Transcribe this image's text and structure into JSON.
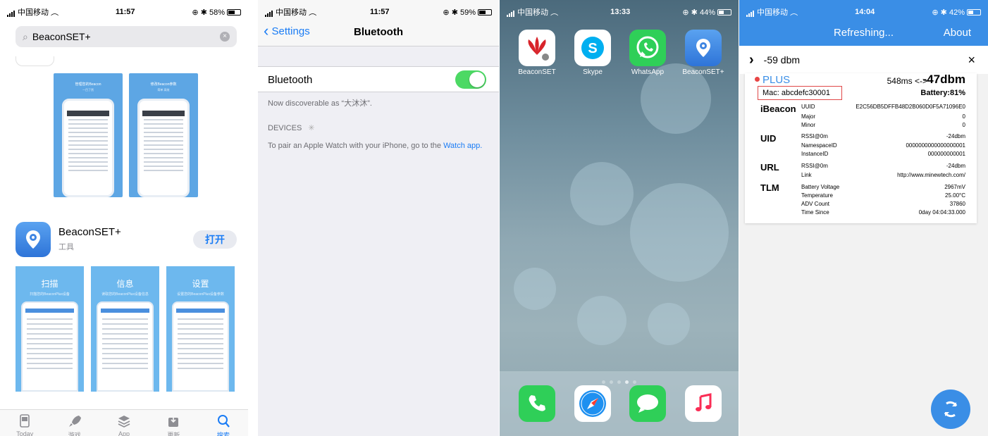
{
  "appstore": {
    "status": {
      "carrier": "中国移动",
      "time": "11:57",
      "battery": "58%",
      "battery_level": 0.58
    },
    "search": {
      "query": "BeaconSET+",
      "clear": "×"
    },
    "app": {
      "name": "BeaconSET+",
      "category": "工具",
      "open_label": "打开"
    },
    "top_shots": {
      "shot1_title": "管理您的Beacon",
      "shot1_sub": "一目了然",
      "shot2_title": "修改Beacon参数",
      "shot2_sub": "简单 高效"
    },
    "screenshots": [
      {
        "title": "扫描",
        "subtitle": "扫描您的BeaconPlus设备"
      },
      {
        "title": "信息",
        "subtitle": "读取您的BeaconPlus设备信息"
      },
      {
        "title": "设置",
        "subtitle": "设置您的BeaconPlus设备参数"
      }
    ],
    "tabs": [
      {
        "label": "Today",
        "icon": "today-icon"
      },
      {
        "label": "游戏",
        "icon": "rocket-icon"
      },
      {
        "label": "App",
        "icon": "layers-icon"
      },
      {
        "label": "更新",
        "icon": "download-icon"
      },
      {
        "label": "搜索",
        "icon": "search-icon"
      }
    ]
  },
  "bluetooth": {
    "status": {
      "carrier": "中国移动",
      "time": "11:57",
      "battery": "59%",
      "battery_level": 0.59
    },
    "nav": {
      "back": "Settings",
      "title": "Bluetooth"
    },
    "row_label": "Bluetooth",
    "toggle_on": true,
    "discoverable": "Now discoverable as “大沐沐”.",
    "devices_header": "DEVICES",
    "watch_text": "To pair an Apple Watch with your iPhone, go to the ",
    "watch_link": "Watch app."
  },
  "home": {
    "status": {
      "carrier": "中国移动",
      "time": "13:33",
      "battery": "44%",
      "battery_level": 0.44
    },
    "apps": [
      {
        "label": "BeaconSET",
        "icon": "beaconset-icon"
      },
      {
        "label": "Skype",
        "icon": "skype-icon"
      },
      {
        "label": "WhatsApp",
        "icon": "whatsapp-icon"
      },
      {
        "label": "BeaconSET+",
        "icon": "beaconset-plus-icon"
      }
    ],
    "page_count": 5,
    "current_page": 3,
    "dock": [
      "phone-icon",
      "safari-icon",
      "messages-icon",
      "music-icon"
    ]
  },
  "beacon": {
    "status": {
      "carrier": "中国移动",
      "time": "14:04",
      "battery": "42%",
      "battery_level": 0.42
    },
    "header": {
      "title": "Refreshing...",
      "about": "About"
    },
    "filter": {
      "chevron": "›",
      "value": "-59 dbm",
      "close": "×"
    },
    "device": {
      "name": "PLUS",
      "interval": "548ms <->",
      "rssi": "-47dbm",
      "mac": "Mac: abcdefc30001",
      "battery": "Battery:81%"
    },
    "sections": [
      {
        "name": "iBeacon",
        "rows": [
          {
            "k": "UUID",
            "v": "E2C56DB5DFFB48D2B060D0F5A71096E0"
          },
          {
            "k": "Major",
            "v": "0"
          },
          {
            "k": "Minor",
            "v": "0"
          }
        ]
      },
      {
        "name": "UID",
        "rows": [
          {
            "k": "RSSI@0m",
            "v": "-24dbm"
          },
          {
            "k": "NamespaceID",
            "v": "0000000000000000001"
          },
          {
            "k": "InstanceID",
            "v": "000000000001"
          }
        ]
      },
      {
        "name": "URL",
        "rows": [
          {
            "k": "RSSI@0m",
            "v": "-24dbm"
          },
          {
            "k": "Link",
            "v": "http://www.minewtech.com/"
          }
        ]
      },
      {
        "name": "TLM",
        "rows": [
          {
            "k": "Battery Voltage",
            "v": "2967mV"
          },
          {
            "k": "Temperature",
            "v": "25.00°C"
          },
          {
            "k": "ADV Count",
            "v": "37860"
          },
          {
            "k": "Time Since",
            "v": "0day 04:04:33.000"
          }
        ]
      }
    ]
  }
}
